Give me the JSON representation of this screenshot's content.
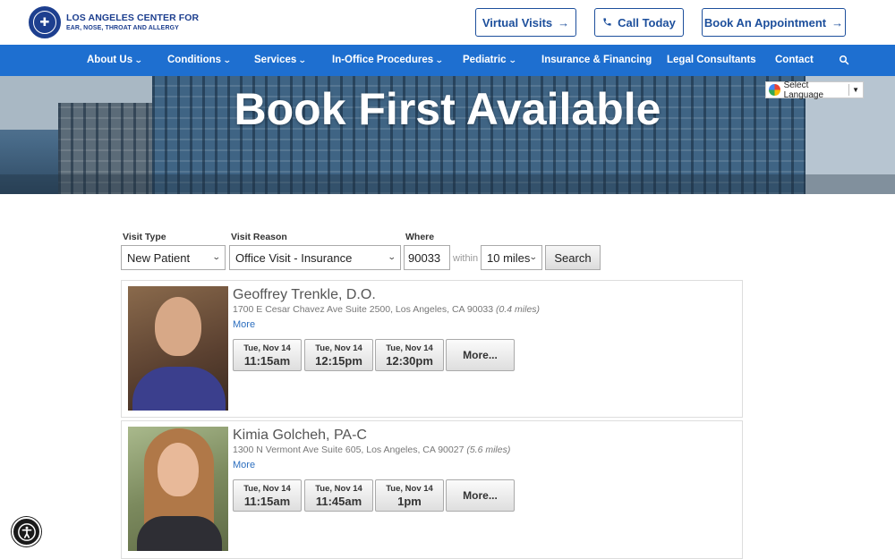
{
  "header": {
    "logo_line1": "LOS ANGELES CENTER FOR",
    "logo_line2": "EAR, NOSE, THROAT AND ALLERGY",
    "virtual_visits": "Virtual Visits",
    "call_today": "Call Today",
    "book_appointment": "Book An Appointment"
  },
  "nav": {
    "items": [
      "About Us",
      "Conditions",
      "Services",
      "In-Office Procedures",
      "Pediatric",
      "Insurance & Financing",
      "Legal Consultants",
      "Contact"
    ]
  },
  "hero": {
    "title": "Book First Available",
    "language_select": "Select Language"
  },
  "search": {
    "visit_type_label": "Visit Type",
    "visit_type_value": "New Patient",
    "visit_reason_label": "Visit Reason",
    "visit_reason_value": "Office Visit - Insurance",
    "where_label": "Where",
    "zip_value": "90033",
    "within_text": "within",
    "radius_value": "10 miles",
    "search_button": "Search"
  },
  "providers": [
    {
      "name": "Geoffrey Trenkle, D.O.",
      "address": "1700 E Cesar Chavez Ave Suite 2500, Los Angeles, CA 90033",
      "distance": "(0.4 miles)",
      "more_link": "More",
      "slots": [
        {
          "date": "Tue, Nov 14",
          "time": "11:15am"
        },
        {
          "date": "Tue, Nov 14",
          "time": "12:15pm"
        },
        {
          "date": "Tue, Nov 14",
          "time": "12:30pm"
        }
      ],
      "more_button": "More..."
    },
    {
      "name": "Kimia Golcheh, PA-C",
      "address": "1300 N Vermont Ave Suite 605, Los Angeles, CA 90027",
      "distance": "(5.6 miles)",
      "more_link": "More",
      "slots": [
        {
          "date": "Tue, Nov 14",
          "time": "11:15am"
        },
        {
          "date": "Tue, Nov 14",
          "time": "11:45am"
        },
        {
          "date": "Tue, Nov 14",
          "time": "1pm"
        }
      ],
      "more_button": "More..."
    }
  ],
  "colors": {
    "brand_blue": "#1d4f9c",
    "nav_blue": "#1e6fd0",
    "link_blue": "#2d6fbf"
  },
  "icons": {
    "logo": "medical-seal-icon",
    "call": "phone-icon",
    "arrow": "arrow-right-icon",
    "search": "search-icon",
    "accessibility": "accessibility-icon"
  }
}
